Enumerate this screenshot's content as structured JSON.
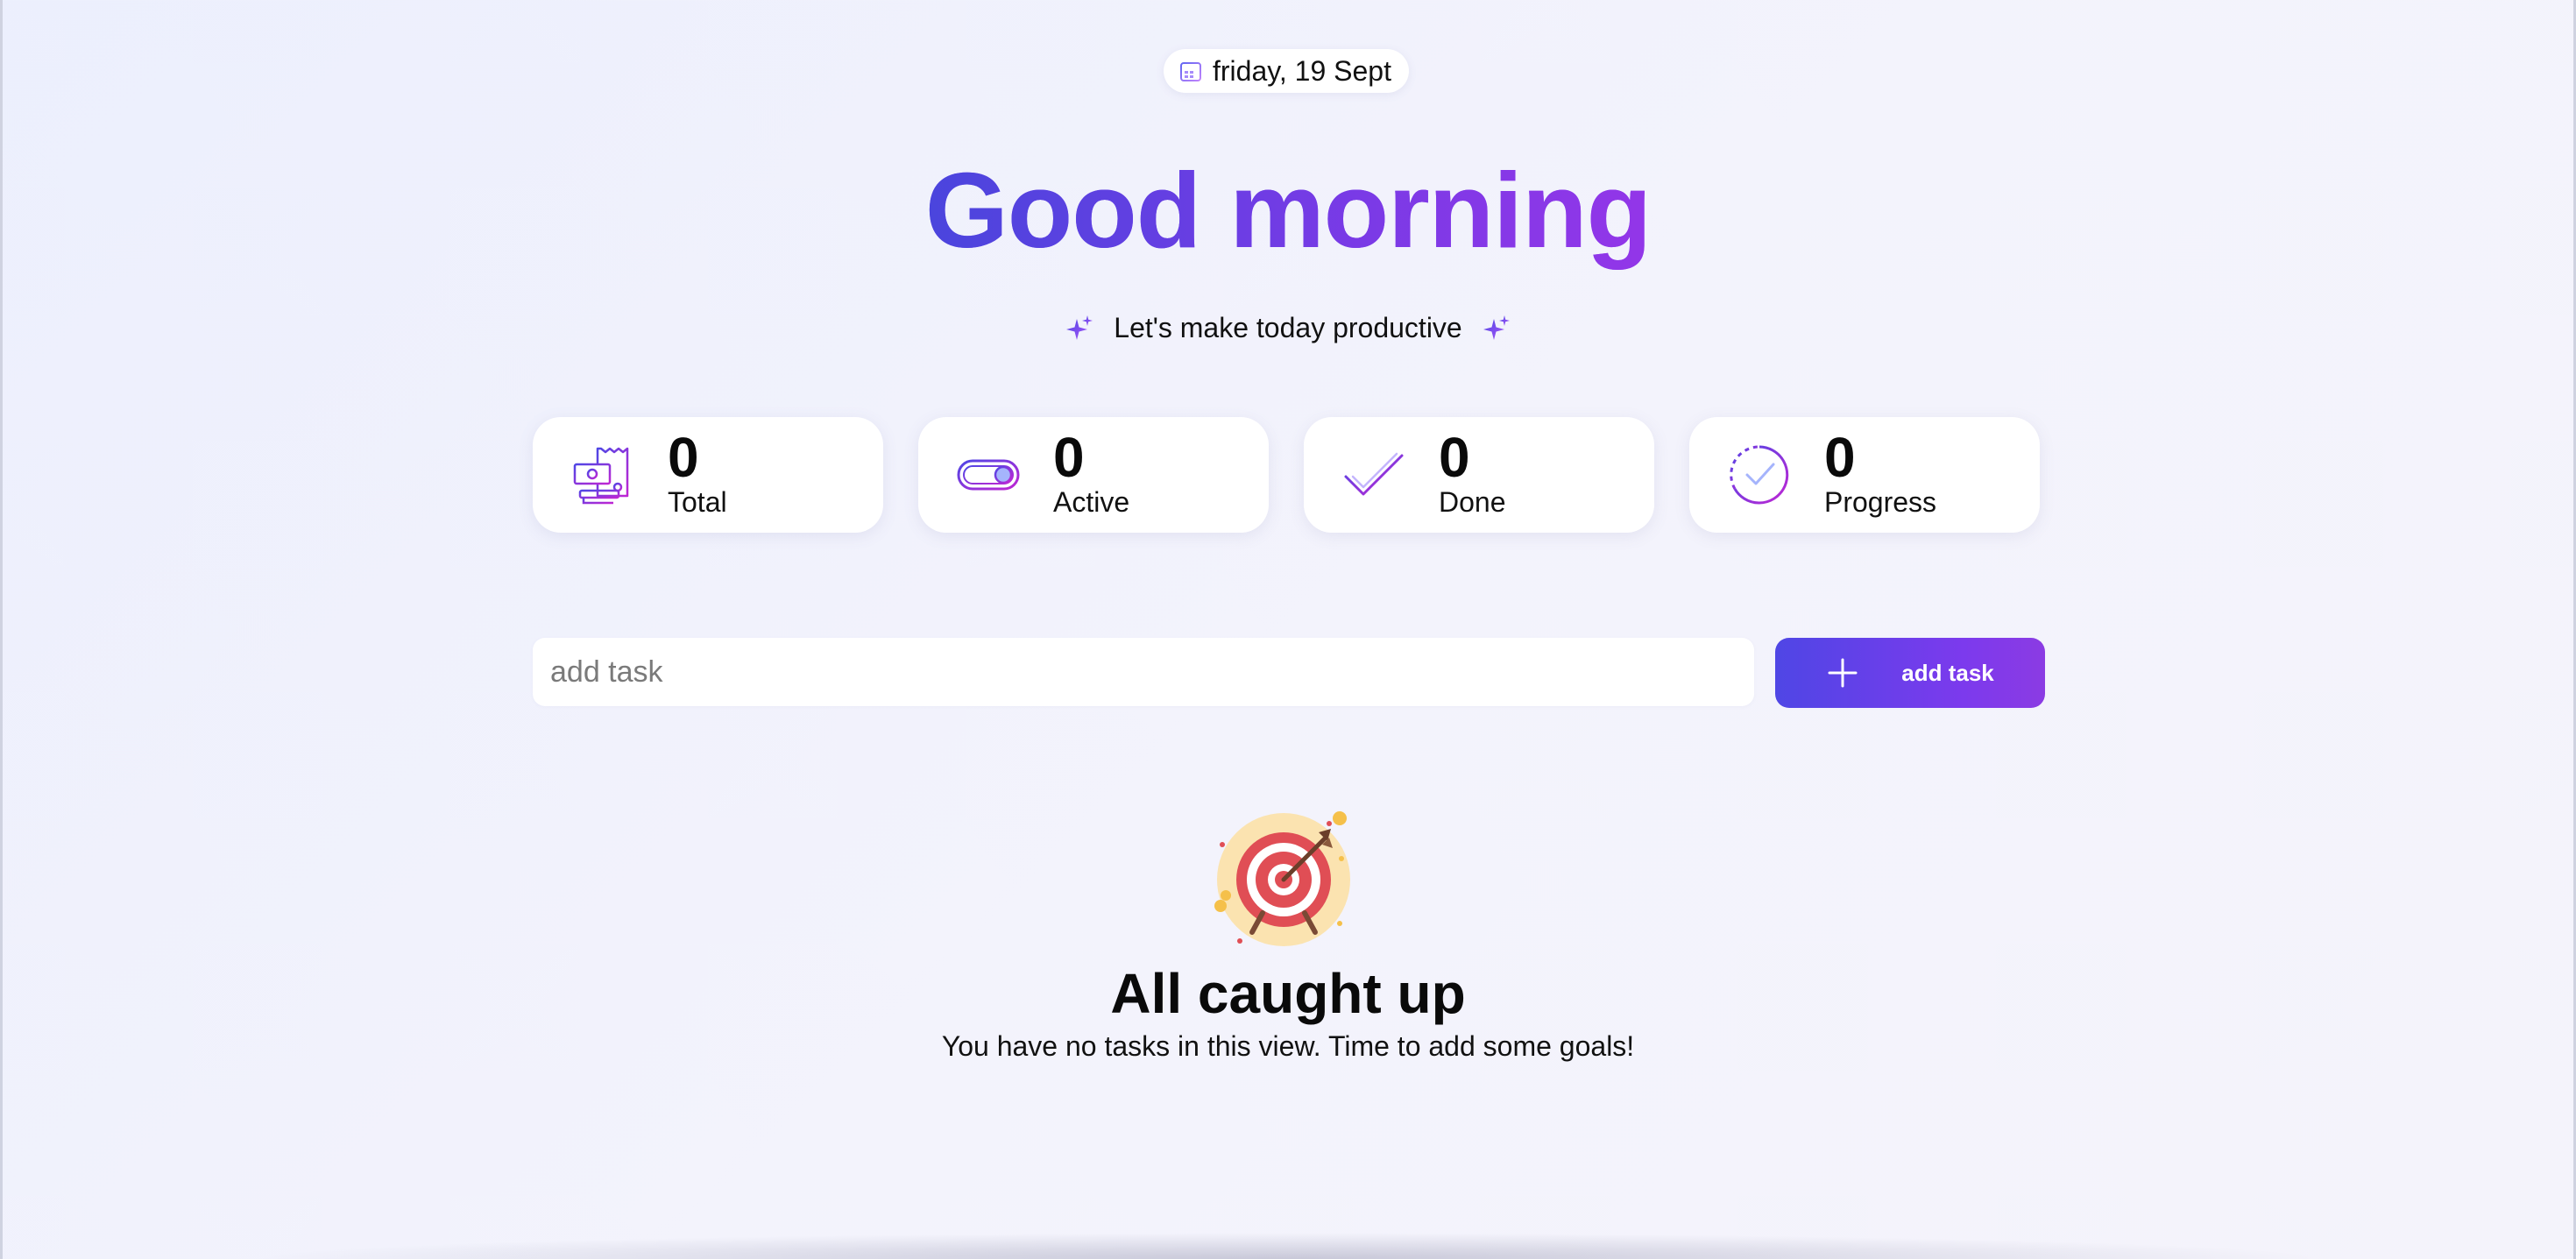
{
  "header": {
    "date": "friday, 19 Sept",
    "date_icon": "calendar-icon",
    "greeting": "Good morning",
    "subtitle": "Let's make today productive",
    "subtitle_icon": "sparkle-icon"
  },
  "stats": [
    {
      "value": "0",
      "label": "Total",
      "icon": "receipt-money-icon"
    },
    {
      "value": "0",
      "label": "Active",
      "icon": "toggle-icon"
    },
    {
      "value": "0",
      "label": "Done",
      "icon": "checkmark-icon"
    },
    {
      "value": "0",
      "label": "Progress",
      "icon": "dashed-circle-check-icon"
    }
  ],
  "add_task": {
    "placeholder": "add task",
    "value": "",
    "button_label": "add task",
    "button_icon": "plus-icon"
  },
  "empty_state": {
    "icon": "target-icon",
    "title": "All caught up",
    "message": "You have no tasks in this view. Time to add some goals!"
  },
  "colors": {
    "accent_start": "#4f46e5",
    "accent_end": "#9333ea",
    "background": "#f1f2fc",
    "card": "#ffffff"
  }
}
